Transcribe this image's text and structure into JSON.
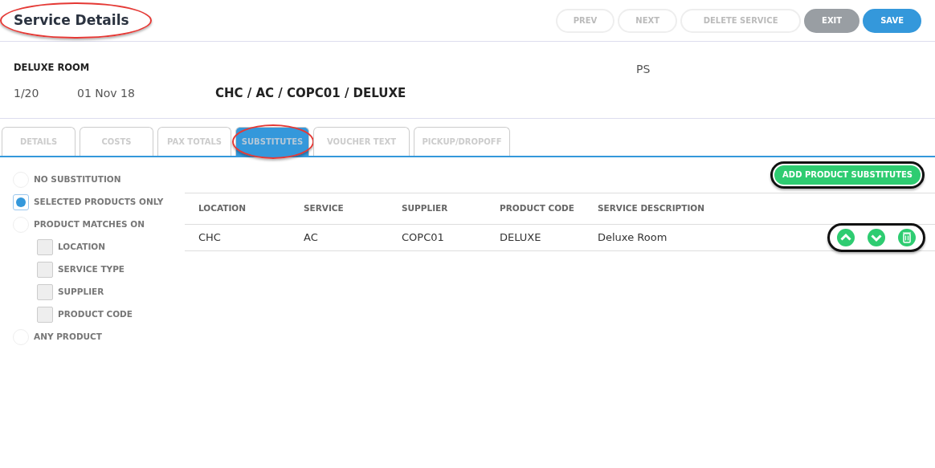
{
  "header": {
    "title": "Service Details",
    "title_circled": true
  },
  "actions": [
    {
      "label": "PREV",
      "kind": "outline",
      "disabled": true
    },
    {
      "label": "NEXT",
      "kind": "outline",
      "disabled": true
    },
    {
      "label": "DELETE SERVICE",
      "kind": "outline",
      "disabled": true
    },
    {
      "label": "EXIT",
      "kind": "grey",
      "disabled": false
    },
    {
      "label": "SAVE",
      "kind": "blue",
      "disabled": false
    }
  ],
  "service": {
    "name": "DELUXE ROOM",
    "code": "PS",
    "sequence": "1/20",
    "date": "01 Nov 18",
    "path": "CHC / AC / COPC01 / DELUXE"
  },
  "tabs": [
    {
      "label": "DETAILS",
      "selected": false,
      "circled": false
    },
    {
      "label": "COSTS",
      "selected": false,
      "circled": false
    },
    {
      "label": "PAX TOTALS",
      "selected": false,
      "circled": false
    },
    {
      "label": "SUBSTITUTES",
      "selected": true,
      "circled": true
    },
    {
      "label": "VOUCHER TEXT",
      "selected": false,
      "circled": false
    },
    {
      "label": "PICKUP/DROPOFF",
      "selected": false,
      "circled": false
    }
  ],
  "options": [
    {
      "kind": "radio",
      "label": "NO SUBSTITUTION",
      "selected": false
    },
    {
      "kind": "radio",
      "label": "SELECTED PRODUCTS ONLY",
      "selected": true
    },
    {
      "kind": "radio",
      "label": "PRODUCT MATCHES ON",
      "selected": false,
      "children": [
        {
          "kind": "checkbox",
          "label": "LOCATION",
          "checked": false
        },
        {
          "kind": "checkbox",
          "label": "SERVICE TYPE",
          "checked": false
        },
        {
          "kind": "checkbox",
          "label": "SUPPLIER",
          "checked": false
        },
        {
          "kind": "checkbox",
          "label": "PRODUCT CODE",
          "checked": false
        }
      ]
    },
    {
      "kind": "radio",
      "label": "ANY PRODUCT",
      "selected": false
    }
  ],
  "add_button": {
    "label": "ADD PRODUCT SUBSTITUTES",
    "circled": true
  },
  "table": {
    "columns": [
      "LOCATION",
      "SERVICE",
      "SUPPLIER",
      "PRODUCT CODE",
      "SERVICE DESCRIPTION"
    ],
    "rows": [
      {
        "cells": [
          "CHC",
          "AC",
          "COPC01",
          "DELUXE",
          "Deluxe Room"
        ],
        "actions_circled": true
      }
    ]
  }
}
